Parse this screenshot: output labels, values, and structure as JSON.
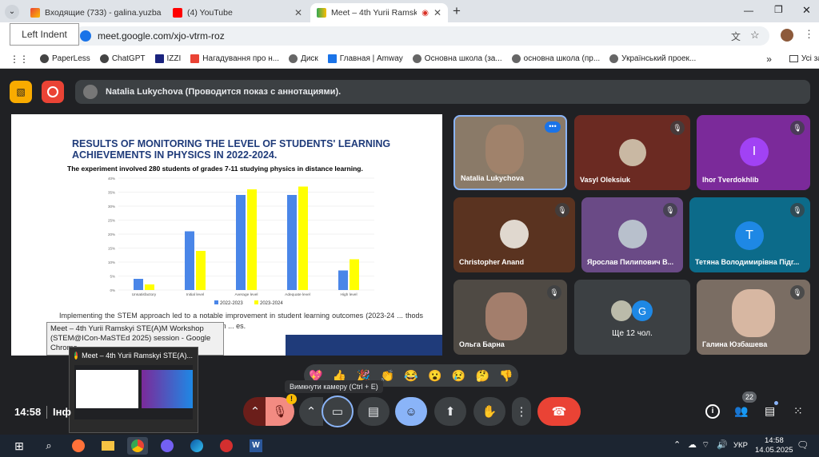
{
  "browser": {
    "tabs": [
      {
        "label": "Входящие (733) - galina.yuzba",
        "icon": "gmail-icon"
      },
      {
        "label": "(4) YouTube",
        "icon": "youtube-icon"
      },
      {
        "label": "Meet – 4th Yurii Ramskyi STE",
        "icon": "meet-icon"
      }
    ],
    "new_tab": "+",
    "tooltip_left_indent": "Left Indent",
    "url": "meet.google.com/xjo-vtrm-roz",
    "bookmarks": [
      "PaperLess",
      "ChatGPT",
      "IZZI",
      "Нагадування про н...",
      "Диск",
      "Главная | Amway",
      "Основна школа (за...",
      "основна школа (пр...",
      "Український проек..."
    ],
    "bookmarks_more": "»",
    "all_bookmarks": "Усі закладки"
  },
  "meet": {
    "presenter_banner": "Natalia Lukychova (Проводится показ с аннотациями).",
    "slide": {
      "title": "RESULTS OF MONITORING THE LEVEL OF STUDENTS' LEARNING ACHIEVEMENTS IN PHYSICS IN 2022-2024.",
      "subtitle": "The experiment involved 280 students of grades 7-11 studying physics in distance learning.",
      "body": "Implementing the STEM approach led to a notable improvement in student learning outcomes (2023-24 ... thods (2022-23 control group), evidenced by a decrease in ... es."
    },
    "chart_data": {
      "type": "bar",
      "categories": [
        "Unsatisfactory",
        "Initial level",
        "Average level",
        "Adequate level",
        "High level"
      ],
      "series": [
        {
          "name": "2022-2023",
          "values": [
            4,
            21,
            34,
            34,
            7
          ],
          "color": "#4a86e8"
        },
        {
          "name": "2023-2024",
          "values": [
            2,
            14,
            36,
            37,
            11
          ],
          "color": "#ffff00"
        }
      ],
      "yticks": [
        "0%",
        "5%",
        "10%",
        "15%",
        "20%",
        "25%",
        "30%",
        "35%",
        "40%"
      ],
      "ylim": [
        0,
        40
      ],
      "legend": "bottom",
      "grid": true
    },
    "hover_tooltip": "Meet – 4th Yurii Ramskyi STE(A)M Workshop (STEM@ICon-MaSTEd 2025) session - Google Chrome",
    "participants": [
      {
        "name": "Natalia Lukychova",
        "type": "video",
        "muted": false
      },
      {
        "name": "Vasyl Oleksiuk",
        "type": "photo",
        "muted": true
      },
      {
        "name": "Ihor Tverdokhlib",
        "type": "letter",
        "letter": "I",
        "color": "#a142f4",
        "muted": true
      },
      {
        "name": "Christopher Anand",
        "type": "photo",
        "muted": true
      },
      {
        "name": "Ярослав Пилипович В...",
        "type": "photo",
        "muted": true
      },
      {
        "name": "Тетяна Володимирівна Підг...",
        "type": "letter",
        "letter": "T",
        "color": "#1e88e5",
        "muted": true
      },
      {
        "name": "Ольга Барна",
        "type": "video",
        "muted": true
      },
      {
        "name": "Ще 12 чол.",
        "type": "more",
        "letter": "G"
      },
      {
        "name": "Галина Юзбашева",
        "type": "video",
        "muted": true
      }
    ],
    "reactions": [
      "💖",
      "👍",
      "🎉",
      "👏",
      "😂",
      "😮",
      "😢",
      "🤔",
      "👎"
    ],
    "camera_tooltip": "Вимкнути камеру (Ctrl + E)",
    "time": "14:58",
    "meeting_info_partial": "Інф",
    "taskbar_preview_title": "Meet – 4th Yurii Ramskyi STE(A)...",
    "people_count": "22"
  },
  "taskbar": {
    "lang": "УКР",
    "time": "14:58",
    "date": "14.05.2025"
  },
  "colors": {
    "meet_bg": "#202124",
    "end_call": "#ea4335",
    "active_blue": "#8ab4f8"
  }
}
